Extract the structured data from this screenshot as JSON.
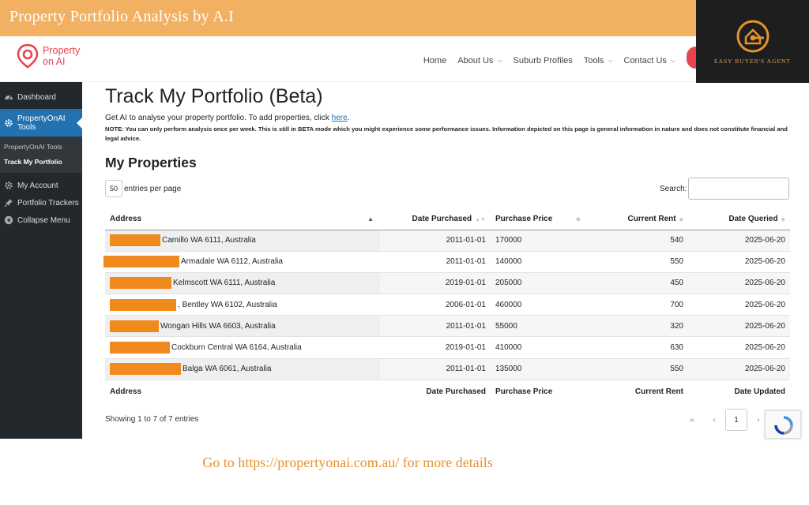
{
  "banner": {
    "title": "Property Portfolio Analysis by A.I"
  },
  "brand": {
    "text": "EASY BUYER'S AGENT",
    "color": "#e8922e"
  },
  "site": {
    "logo_text": "Property on AI",
    "accent": "#e8434f"
  },
  "nav": {
    "items": [
      {
        "label": "Home",
        "dropdown": false
      },
      {
        "label": "About Us",
        "dropdown": true
      },
      {
        "label": "Suburb Profiles",
        "dropdown": false
      },
      {
        "label": "Tools",
        "dropdown": true
      },
      {
        "label": "Contact Us",
        "dropdown": true
      }
    ]
  },
  "sidebar": {
    "dashboard": "Dashboard",
    "tools": "PropertyOnAI Tools",
    "sub_tools": "PropertyOnAI Tools",
    "sub_portfolio": "Track My Portfolio",
    "account": "My Account",
    "trackers": "Portfolio Trackers",
    "collapse": "Collapse Menu",
    "active_color": "#2271b1"
  },
  "page": {
    "title": "Track My Portfolio (Beta)",
    "intro": "Get AI to analyse your property portfolio. To add properties, click",
    "intro_link": "here",
    "intro_end": ".",
    "note": "NOTE: You can only perform analysis once per week. This is still in BETA mode which you might experience some performance issues. Information depicted on this page is general information in nature and does not constitute financial and legal advice.",
    "section_title": "My Properties"
  },
  "table": {
    "length_value": "50",
    "length_label": "entries per page",
    "search_label": "Search:",
    "search_value": "",
    "headers": {
      "address": "Address",
      "date_purchased": "Date Purchased",
      "purchase_price": "Purchase Price",
      "current_rent": "Current Rent",
      "date_queried": "Date Queried"
    },
    "footers": {
      "address": "Address",
      "date_purchased": "Date Purchased",
      "purchase_price": "Purchase Price",
      "current_rent": "Current Rent",
      "date_updated": "Date Updated"
    },
    "rows": [
      {
        "address": "Camillo WA 6111, Australia",
        "date_purchased": "2011-01-01",
        "purchase_price": "170000",
        "current_rent": "540",
        "date_queried": "2025-06-20"
      },
      {
        "address": "Armadale WA 6112, Australia",
        "date_purchased": "2011-01-01",
        "purchase_price": "140000",
        "current_rent": "550",
        "date_queried": "2025-06-20"
      },
      {
        "address": "Kelmscott WA 6111, Australia",
        "date_purchased": "2019-01-01",
        "purchase_price": "205000",
        "current_rent": "450",
        "date_queried": "2025-06-20"
      },
      {
        "address": ", Bentley WA 6102, Australia",
        "date_purchased": "2006-01-01",
        "purchase_price": "460000",
        "current_rent": "700",
        "date_queried": "2025-06-20"
      },
      {
        "address": "Wongan Hills WA 6603, Australia",
        "date_purchased": "2011-01-01",
        "purchase_price": "55000",
        "current_rent": "320",
        "date_queried": "2025-06-20"
      },
      {
        "address": "Cockburn Central WA 6164, Australia",
        "date_purchased": "2019-01-01",
        "purchase_price": "410000",
        "current_rent": "630",
        "date_queried": "2025-06-20"
      },
      {
        "address": "Balga WA 6061, Australia",
        "date_purchased": "2011-01-01",
        "purchase_price": "135000",
        "current_rent": "550",
        "date_queried": "2025-06-20"
      }
    ],
    "info": "Showing 1 to 7 of 7 entries",
    "pager": {
      "first": "«",
      "prev": "‹",
      "current": "1",
      "next": "›"
    }
  },
  "footer": {
    "text": "Go to https://propertyonai.com.au/ for more details"
  }
}
